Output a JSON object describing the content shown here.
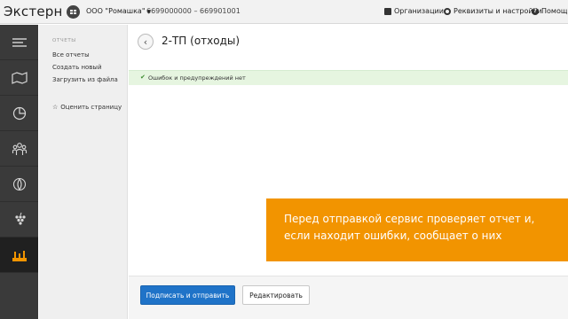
{
  "app": {
    "title": "Экстерн"
  },
  "org": {
    "name": "ООО \"Ромашка\"",
    "inn_kpp": "6699000000 – 669901001",
    "icon": "org-icon"
  },
  "topnav": [
    {
      "label": "Организации",
      "icon": "briefcase-icon"
    },
    {
      "label": "Реквизиты и настройки",
      "icon": "gear-icon"
    },
    {
      "label": "Помощь",
      "icon": "help-icon"
    }
  ],
  "iconbar": [
    {
      "icon": "menu-lines-icon",
      "active": false
    },
    {
      "icon": "map-icon",
      "active": false
    },
    {
      "icon": "pie-chart-icon",
      "active": false
    },
    {
      "icon": "people-group-icon",
      "active": false
    },
    {
      "icon": "leaf-coin-icon",
      "active": false
    },
    {
      "icon": "grapes-icon",
      "active": false
    },
    {
      "icon": "factory-icon",
      "active": true
    }
  ],
  "sidebar": {
    "heading": "ОТЧЕТЫ",
    "items": [
      {
        "label": "Все отчеты"
      },
      {
        "label": "Создать новый"
      },
      {
        "label": "Загрузить из файла"
      }
    ],
    "rate": {
      "label": "Оценить страницу",
      "icon": "star-icon"
    }
  },
  "main": {
    "title": "2-ТП (отходы)",
    "status": {
      "text": "Ошибок и предупреждений нет",
      "icon": "check-icon"
    }
  },
  "banner": {
    "text": "Перед отправкой сервис проверяет отчет и, если находит ошибки, сообщает о них",
    "color": "#f29400"
  },
  "footer": {
    "primary_label": "Подписать и отправить",
    "secondary_label": "Редактировать",
    "primary_color": "#1f73c8"
  }
}
